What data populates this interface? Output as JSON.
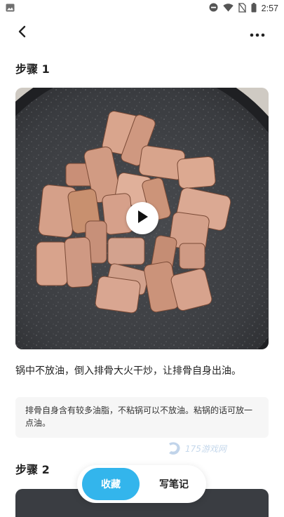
{
  "status_bar": {
    "time": "2:57",
    "icons": [
      "image-icon",
      "do-not-disturb-icon",
      "wifi-icon",
      "no-sim-icon",
      "battery-icon"
    ]
  },
  "nav": {
    "back_icon": "chevron-left-icon",
    "more_icon": "more-horizontal-icon"
  },
  "steps": [
    {
      "title": "步骤 1",
      "description": "锅中不放油，倒入排骨大火干炒，让排骨自身出油。",
      "tip": "排骨自身含有较多油脂，不粘锅可以不放油。粘锅的话可放一点油。"
    },
    {
      "title": "步骤 2"
    }
  ],
  "watermark": {
    "text": "175游戏网"
  },
  "actions": {
    "favorite_label": "收藏",
    "note_label": "写笔记"
  },
  "colors": {
    "accent": "#33b5ec",
    "tip_background": "#f6f6f6"
  }
}
